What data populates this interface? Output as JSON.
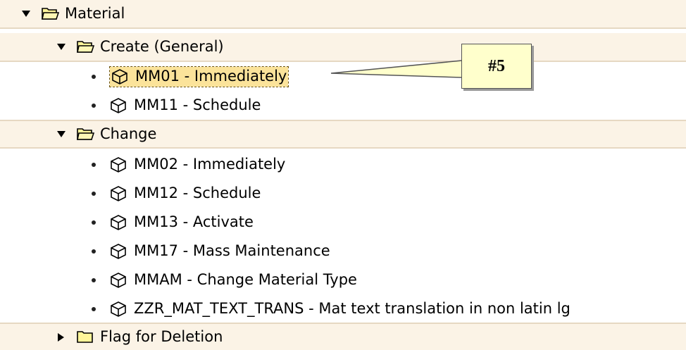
{
  "tree": {
    "material": {
      "label": "Material",
      "state": "expanded"
    },
    "create_general": {
      "label": "Create (General)",
      "state": "expanded",
      "items": [
        {
          "label": "MM01 - Immediately",
          "selected": true
        },
        {
          "label": "MM11 - Schedule",
          "selected": false
        }
      ]
    },
    "change": {
      "label": "Change",
      "state": "expanded",
      "items": [
        {
          "label": "MM02 - Immediately"
        },
        {
          "label": "MM12 - Schedule"
        },
        {
          "label": "MM13 - Activate"
        },
        {
          "label": "MM17 - Mass Maintenance"
        },
        {
          "label": "MMAM - Change Material Type"
        },
        {
          "label": "ZZR_MAT_TEXT_TRANS - Mat text translation in non latin lg"
        }
      ]
    },
    "flag_for_deletion": {
      "label": "Flag for Deletion",
      "state": "collapsed"
    }
  },
  "callout": {
    "text": "#5"
  },
  "colors": {
    "folder_row_bg": "#fbf3e6",
    "selected_bg": "#fbe39a",
    "callout_bg": "#ffffcc"
  },
  "icons": {
    "expanded": "triangle-down-icon",
    "collapsed": "triangle-right-icon",
    "folder_open": "folder-open-icon",
    "folder_closed": "folder-icon",
    "transaction": "transaction-cube-icon",
    "bullet": "bullet-icon"
  }
}
